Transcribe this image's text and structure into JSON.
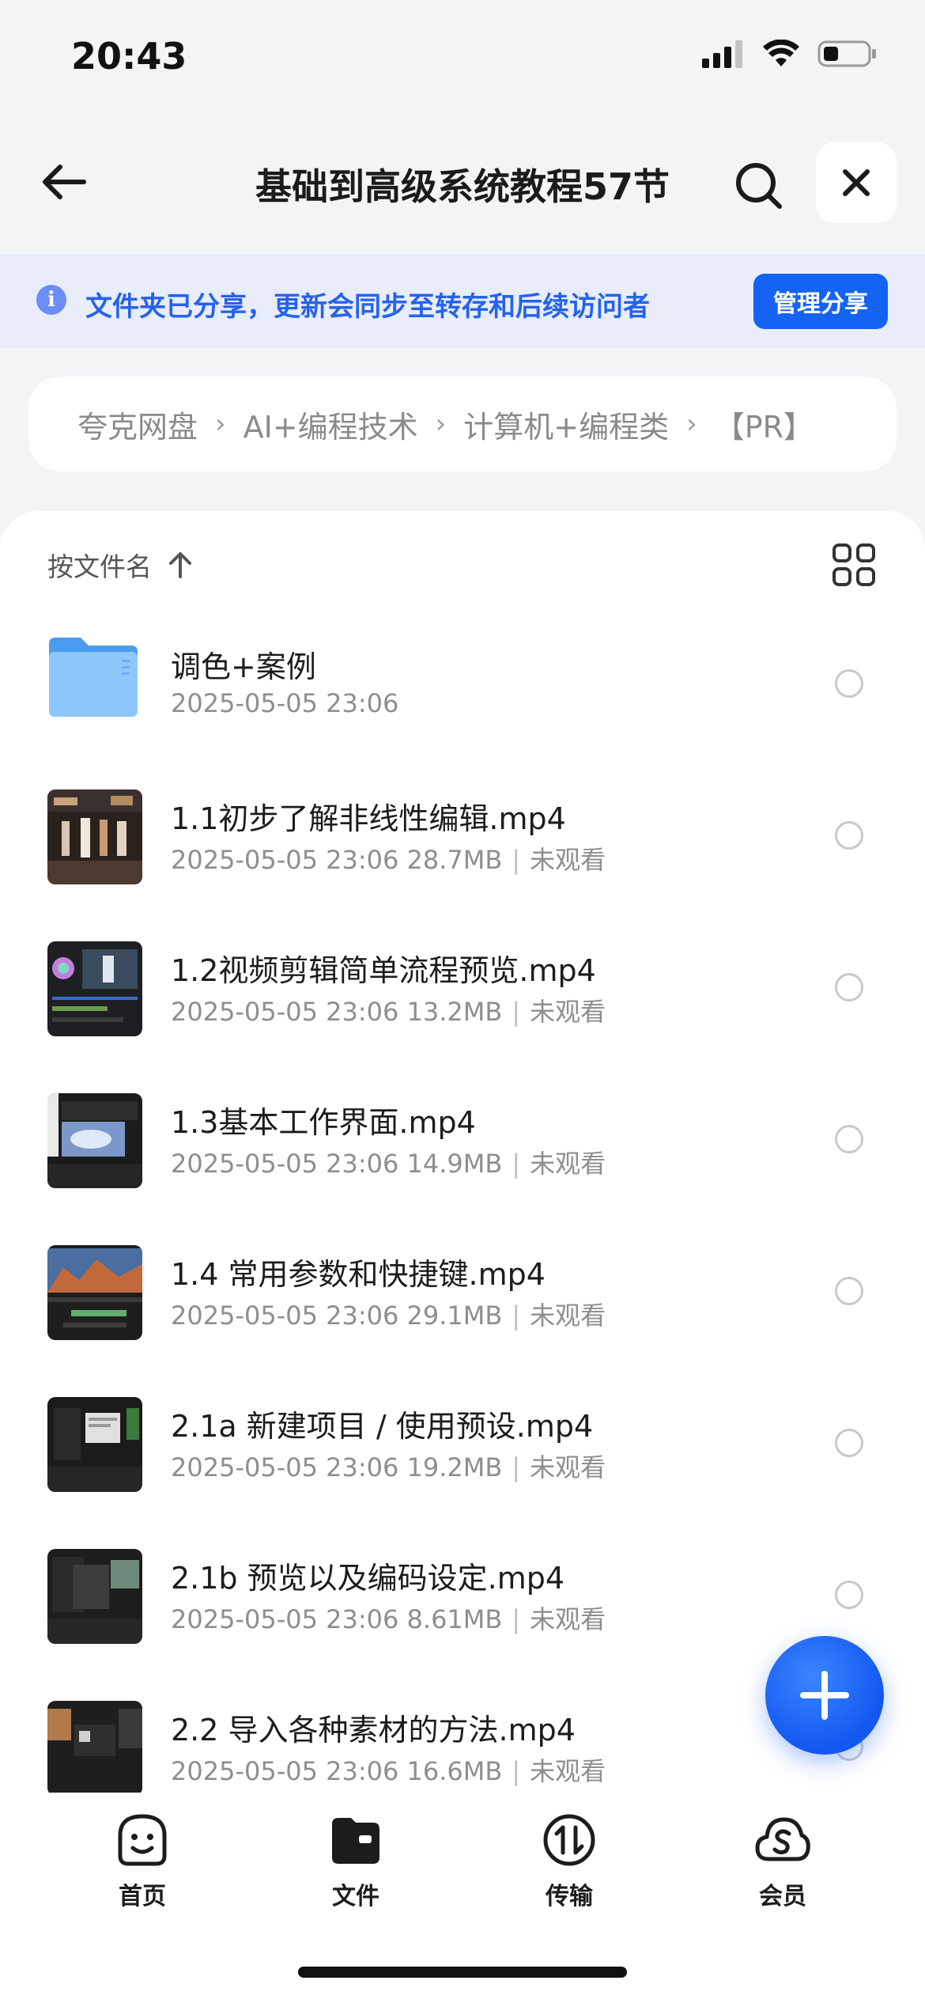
{
  "status_bar": {
    "time": "20:43"
  },
  "nav": {
    "title": "基础到高级系统教程57节"
  },
  "share_banner": {
    "text": "文件夹已分享，更新会同步至转存和后续访问者",
    "button": "管理分享",
    "info_glyph": "i"
  },
  "breadcrumb": [
    "夸克网盘",
    "AI+编程技术",
    "计算机+编程类",
    "【PR】"
  ],
  "breadcrumb_sep": "›",
  "sort": {
    "label": "按文件名"
  },
  "files": [
    {
      "name": "调色+案例",
      "date": "2025-05-05 23:06",
      "size": "",
      "status": "",
      "type": "folder"
    },
    {
      "name": "1.1初步了解非线性编辑.mp4",
      "date": "2025-05-05 23:06",
      "size": "28.7MB",
      "status": "未观看",
      "type": "video"
    },
    {
      "name": "1.2视频剪辑简单流程预览.mp4",
      "date": "2025-05-05 23:06",
      "size": "13.2MB",
      "status": "未观看",
      "type": "video"
    },
    {
      "name": "1.3基本工作界面.mp4",
      "date": "2025-05-05 23:06",
      "size": "14.9MB",
      "status": "未观看",
      "type": "video"
    },
    {
      "name": "1.4 常用参数和快捷键.mp4",
      "date": "2025-05-05 23:06",
      "size": "29.1MB",
      "status": "未观看",
      "type": "video"
    },
    {
      "name": "2.1a 新建项目 / 使用预设.mp4",
      "date": "2025-05-05 23:06",
      "size": "19.2MB",
      "status": "未观看",
      "type": "video"
    },
    {
      "name": "2.1b 预览以及编码设定.mp4",
      "date": "2025-05-05 23:06",
      "size": "8.61MB",
      "status": "未观看",
      "type": "video"
    },
    {
      "name": "2.2 导入各种素材的方法.mp4",
      "date": "2025-05-05 23:06",
      "size": "16.6MB",
      "status": "未观看",
      "type": "video"
    }
  ],
  "tabs": [
    {
      "label": "首页",
      "icon": "smiley-face-icon"
    },
    {
      "label": "文件",
      "icon": "folder-icon"
    },
    {
      "label": "传输",
      "icon": "transfer-icon"
    },
    {
      "label": "会员",
      "icon": "cloud-s-icon"
    }
  ],
  "colors": {
    "accent": "#1463f3",
    "banner_bg": "#e8ecfb",
    "banner_text": "#2563eb",
    "folder": "#5aa9f5"
  }
}
